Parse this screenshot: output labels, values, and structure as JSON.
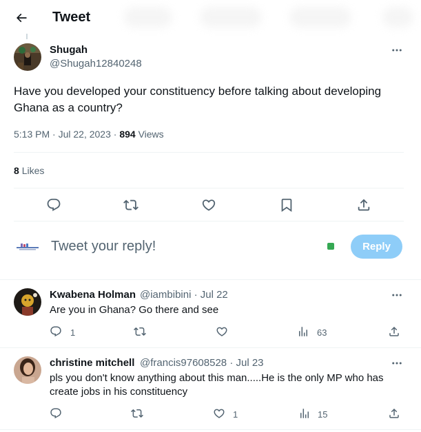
{
  "header": {
    "title": "Tweet"
  },
  "main_tweet": {
    "name": "Shugah",
    "handle": "@Shugah12840248",
    "text": "Have you developed your constituency before talking about developing Ghana as a country?",
    "time": "5:13 PM · Jul 22, 2023 ·",
    "views_count": "894",
    "views_label": "Views",
    "likes_count": "8",
    "likes_label": "Likes"
  },
  "reply_box": {
    "placeholder": "Tweet your reply!",
    "button_label": "Reply"
  },
  "replies": [
    {
      "name": "Kwabena Holman",
      "handle_time": "@iambibini · Jul 22",
      "text": "Are you in Ghana? Go there and see",
      "reply_count": "1",
      "retweet_count": "",
      "like_count": "",
      "view_count": "63"
    },
    {
      "name": "christine mitchell",
      "handle_time": "@francis97608528 · Jul 23",
      "text": "pls you don't know anything about this man.....He is the only MP who has create jobs in his constituency",
      "reply_count": "",
      "retweet_count": "",
      "like_count": "1",
      "view_count": "15"
    }
  ],
  "icons": {
    "back": "arrow-left-icon",
    "more": "more-horizontal-icon",
    "reply": "reply-icon",
    "retweet": "retweet-icon",
    "like": "heart-icon",
    "bookmark": "bookmark-icon",
    "share": "share-icon",
    "views": "views-chart-icon"
  },
  "colors": {
    "accent_disabled": "#8ecdf8",
    "text_primary": "#0f1419",
    "text_secondary": "#536471",
    "divider": "#eff3f4"
  }
}
